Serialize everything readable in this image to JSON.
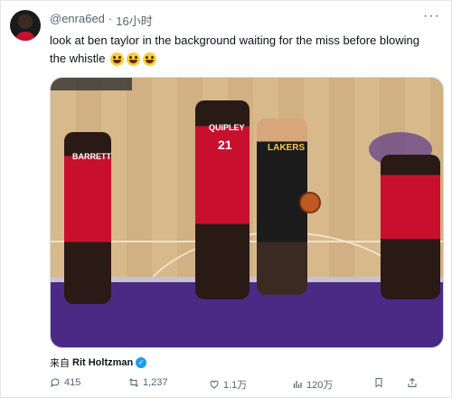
{
  "tweet": {
    "handle": "@enra6ed",
    "separator": "·",
    "time": "16小时",
    "more": "···",
    "text": "look at ben taylor in the background waiting for the miss before blowing the whistle",
    "emojis": [
      "grinning-sweat-face",
      "grinning-sweat-face",
      "grinning-sweat-face"
    ]
  },
  "media": {
    "jersey_labels": {
      "left_player": "BARRETT",
      "center_player": "QUIPLEY",
      "center_number": "21",
      "ball_handler": "LAKERS"
    }
  },
  "attribution": {
    "prefix": "来自",
    "author": "Rit Holtzman",
    "verified_mark": "✓"
  },
  "actions": {
    "reply_count": "415",
    "retweet_count": "1,237",
    "like_count": "1.1万",
    "views_count": "120万"
  },
  "colors": {
    "accent": "#1d9bf0",
    "secondary_text": "#536471",
    "raptors_red": "#c8102e",
    "lakers_purple": "#4b2a86"
  }
}
